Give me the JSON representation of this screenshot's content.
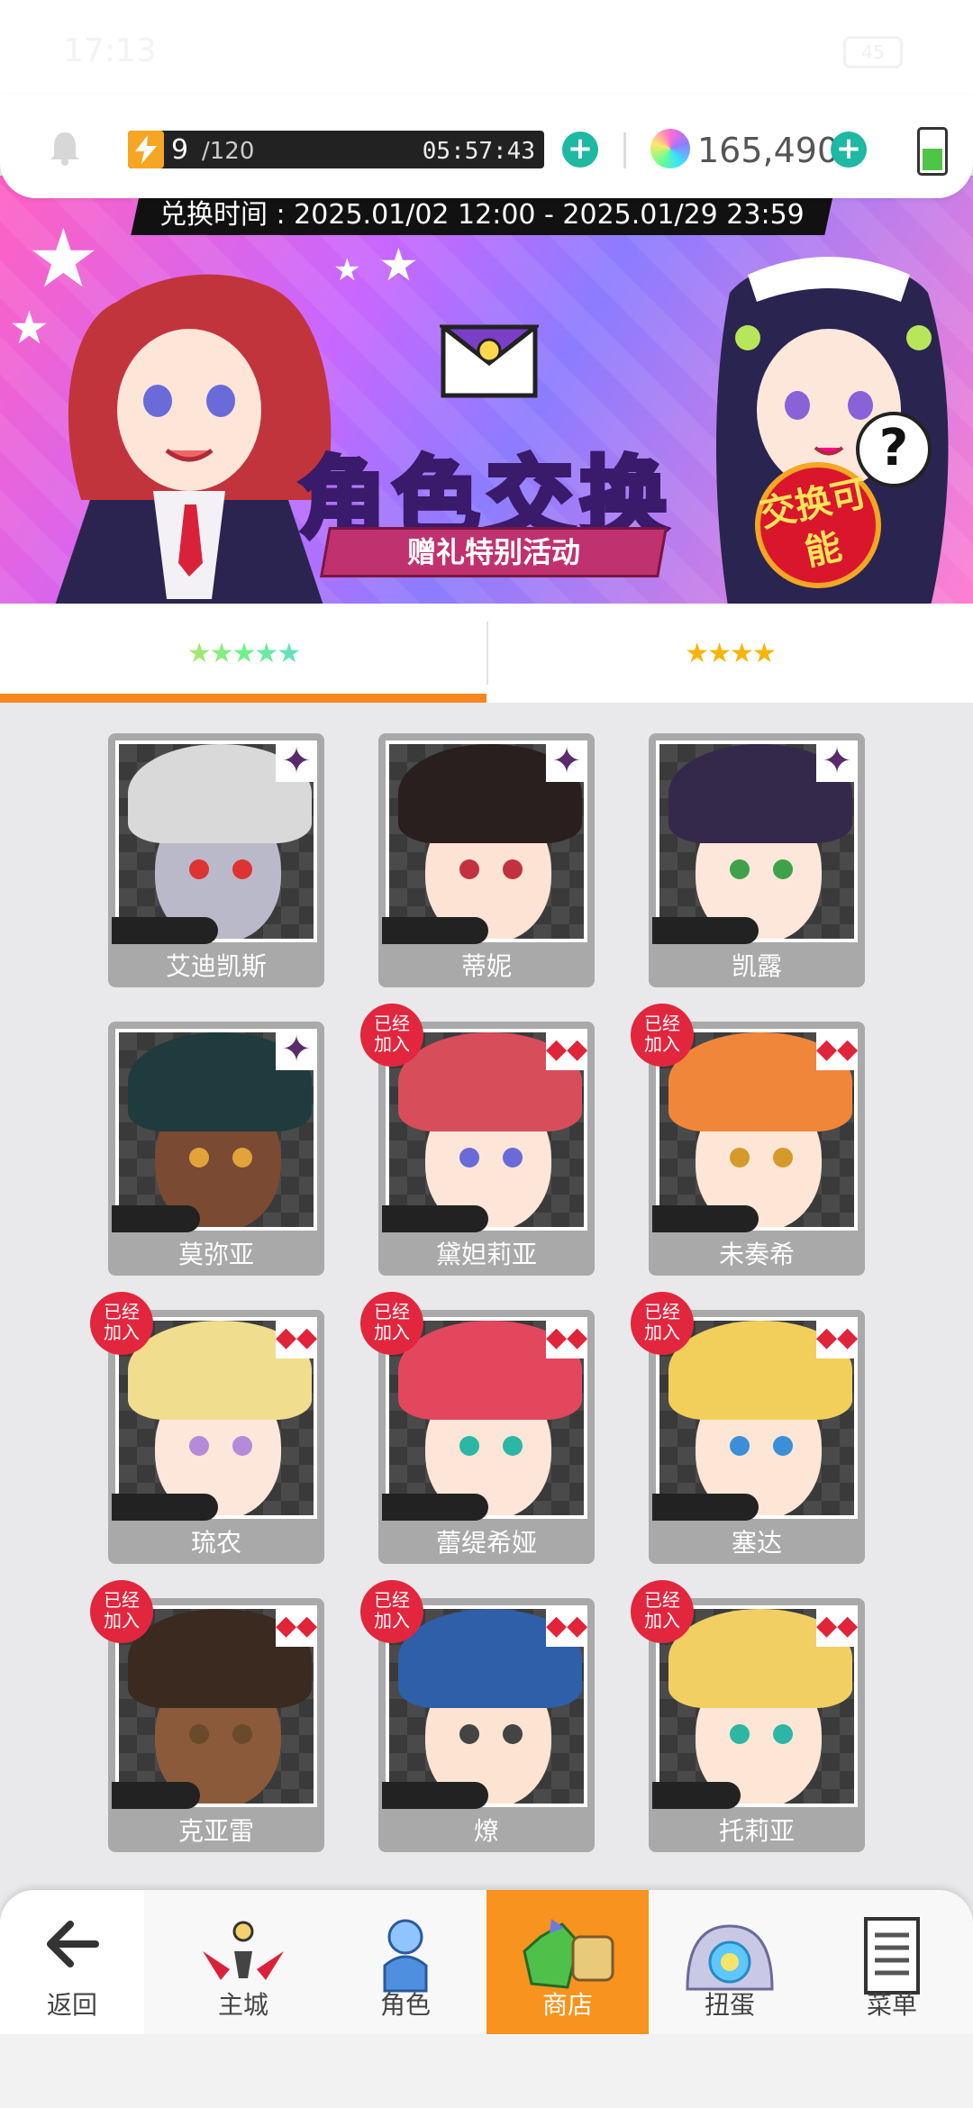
{
  "status_bar": {
    "time": "17:13",
    "battery_text": "45"
  },
  "resources": {
    "stamina_current": "9",
    "stamina_max": "/120",
    "stamina_timer": "05:57:43",
    "gems": "165,490"
  },
  "banner": {
    "period": "兑换时间 : 2025.01/02 12:00 - 2025.01/29 23:59",
    "title": "角色交换",
    "subtitle": "赠礼特别活动",
    "badge": "交换可能",
    "help": "?"
  },
  "tabs": [
    {
      "label": "★★★★★",
      "rarity": 5,
      "active": true
    },
    {
      "label": "★★★★",
      "rarity": 4,
      "active": false
    }
  ],
  "joined_label": [
    "已经",
    "加入"
  ],
  "characters": [
    {
      "name": "艾迪凯斯",
      "stars": "★★★★★",
      "rank_icon": "purple-shuriken-icon",
      "joined": false,
      "hair": "#d9d9d9",
      "skin": "#b9b9c9",
      "eye": "#d33"
    },
    {
      "name": "蒂妮",
      "stars": "★★★★★",
      "rank_icon": "purple-shuriken-icon",
      "joined": false,
      "hair": "#2a1f1f",
      "skin": "#fde3d4",
      "eye": "#c2313f"
    },
    {
      "name": "凯露",
      "stars": "★★★★★",
      "rank_icon": "purple-shuriken-icon",
      "joined": false,
      "hair": "#34294a",
      "skin": "#fde7da",
      "eye": "#3fa14a"
    },
    {
      "name": "莫弥亚",
      "stars": "★★★★",
      "rank_icon": "purple-shuriken-icon",
      "joined": false,
      "hair": "#1f3b3d",
      "skin": "#7a4a32",
      "eye": "#e2a43a"
    },
    {
      "name": "黛妲莉亚",
      "stars": "★★★★★",
      "rank_icon": "red-diamonds-icon",
      "joined": true,
      "hair": "#d84d5a",
      "skin": "#fde5d8",
      "eye": "#6a6ad8"
    },
    {
      "name": "未奏希",
      "stars": "★★★★★",
      "rank_icon": "red-diamonds-icon",
      "joined": true,
      "hair": "#f0863a",
      "skin": "#fde6d6",
      "eye": "#d69a2b"
    },
    {
      "name": "琉农",
      "stars": "★★★★★",
      "rank_icon": "red-diamonds-icon",
      "joined": true,
      "hair": "#f1dd8e",
      "skin": "#fde7da",
      "eye": "#b58ad8"
    },
    {
      "name": "蕾缇希娅",
      "stars": "★★★★★",
      "rank_icon": "red-diamonds-icon",
      "joined": true,
      "hair": "#e2475e",
      "skin": "#fde5d8",
      "eye": "#2bb7a3"
    },
    {
      "name": "塞达",
      "stars": "★★★★★",
      "rank_icon": "red-diamonds-icon",
      "joined": true,
      "hair": "#f2cf5a",
      "skin": "#fde6d6",
      "eye": "#3a8fd8"
    },
    {
      "name": "克亚雷",
      "stars": "★★★★",
      "rank_icon": "red-diamonds-icon",
      "joined": true,
      "hair": "#3a2a1f",
      "skin": "#8a5a3a",
      "eye": "#6a4a2a"
    },
    {
      "name": "燎",
      "stars": "★★★★★",
      "rank_icon": "red-diamonds-icon",
      "joined": true,
      "hair": "#2e5fa8",
      "skin": "#fde3d2",
      "eye": "#444"
    },
    {
      "name": "托莉亚",
      "stars": "★★★★",
      "rank_icon": "red-diamonds-icon",
      "joined": true,
      "hair": "#f2cf62",
      "skin": "#fde6d6",
      "eye": "#2bb7a3"
    }
  ],
  "nav": [
    {
      "label": "返回",
      "icon": "back-arrow-icon"
    },
    {
      "label": "主城",
      "icon": "castle-icon"
    },
    {
      "label": "角色",
      "icon": "character-icon"
    },
    {
      "label": "商店",
      "icon": "shop-icon",
      "active": true
    },
    {
      "label": "扭蛋",
      "icon": "gacha-icon"
    },
    {
      "label": "菜单",
      "icon": "menu-icon"
    }
  ],
  "colors": {
    "accent": "#f7871c",
    "teal": "#1eb8a3",
    "joined_red": "#e2263e",
    "shop_active": "#f7931e"
  }
}
